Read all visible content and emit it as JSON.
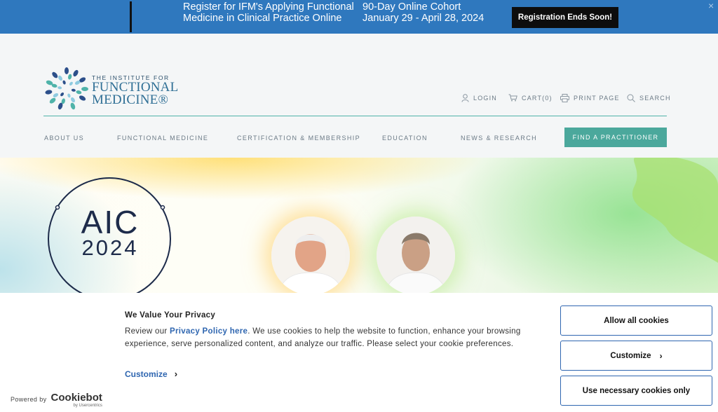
{
  "promo": {
    "line1a": "Register for IFM's Applying Functional",
    "line1b": "Medicine in Clinical Practice Online",
    "line2a": "90-Day Online Cohort",
    "line2b": "January 29 - April 28, 2024",
    "cta": "Registration Ends Soon!",
    "close": "×"
  },
  "logo": {
    "line1": "THE INSTITUTE FOR",
    "line2": "FUNCTIONAL",
    "line3": "MEDICINE®"
  },
  "utility": {
    "login": "LOGIN",
    "cart": "CART(0)",
    "print": "PRINT PAGE",
    "search": "SEARCH"
  },
  "nav": {
    "about": "ABOUT US",
    "fm": "FUNCTIONAL MEDICINE",
    "cert": "CERTIFICATION & MEMBERSHIP",
    "edu": "EDUCATION",
    "news": "NEWS & RESEARCH",
    "find": "FIND A PRACTITIONER"
  },
  "hero": {
    "aic": "AIC",
    "year": "2024"
  },
  "cookie": {
    "title": "We Value Your Privacy",
    "body_pre": "Review our ",
    "policy_link": "Privacy Policy here",
    "body_post": ". We use cookies to help the website to function, enhance your browsing experience, serve personalized content, and analyze our traffic. Please select your cookie preferences.",
    "customize_link": "Customize",
    "allow_all": "Allow all cookies",
    "customize_btn": "Customize",
    "necessary": "Use necessary cookies only",
    "powered_by": "Powered by",
    "brand": "Cookiebot",
    "brand_sub": "by Usercentrics"
  },
  "colors": {
    "promo_bg": "#2f78be",
    "teal": "#4ba89c",
    "navy": "#1d2b4a",
    "link_blue": "#2f66b0"
  }
}
